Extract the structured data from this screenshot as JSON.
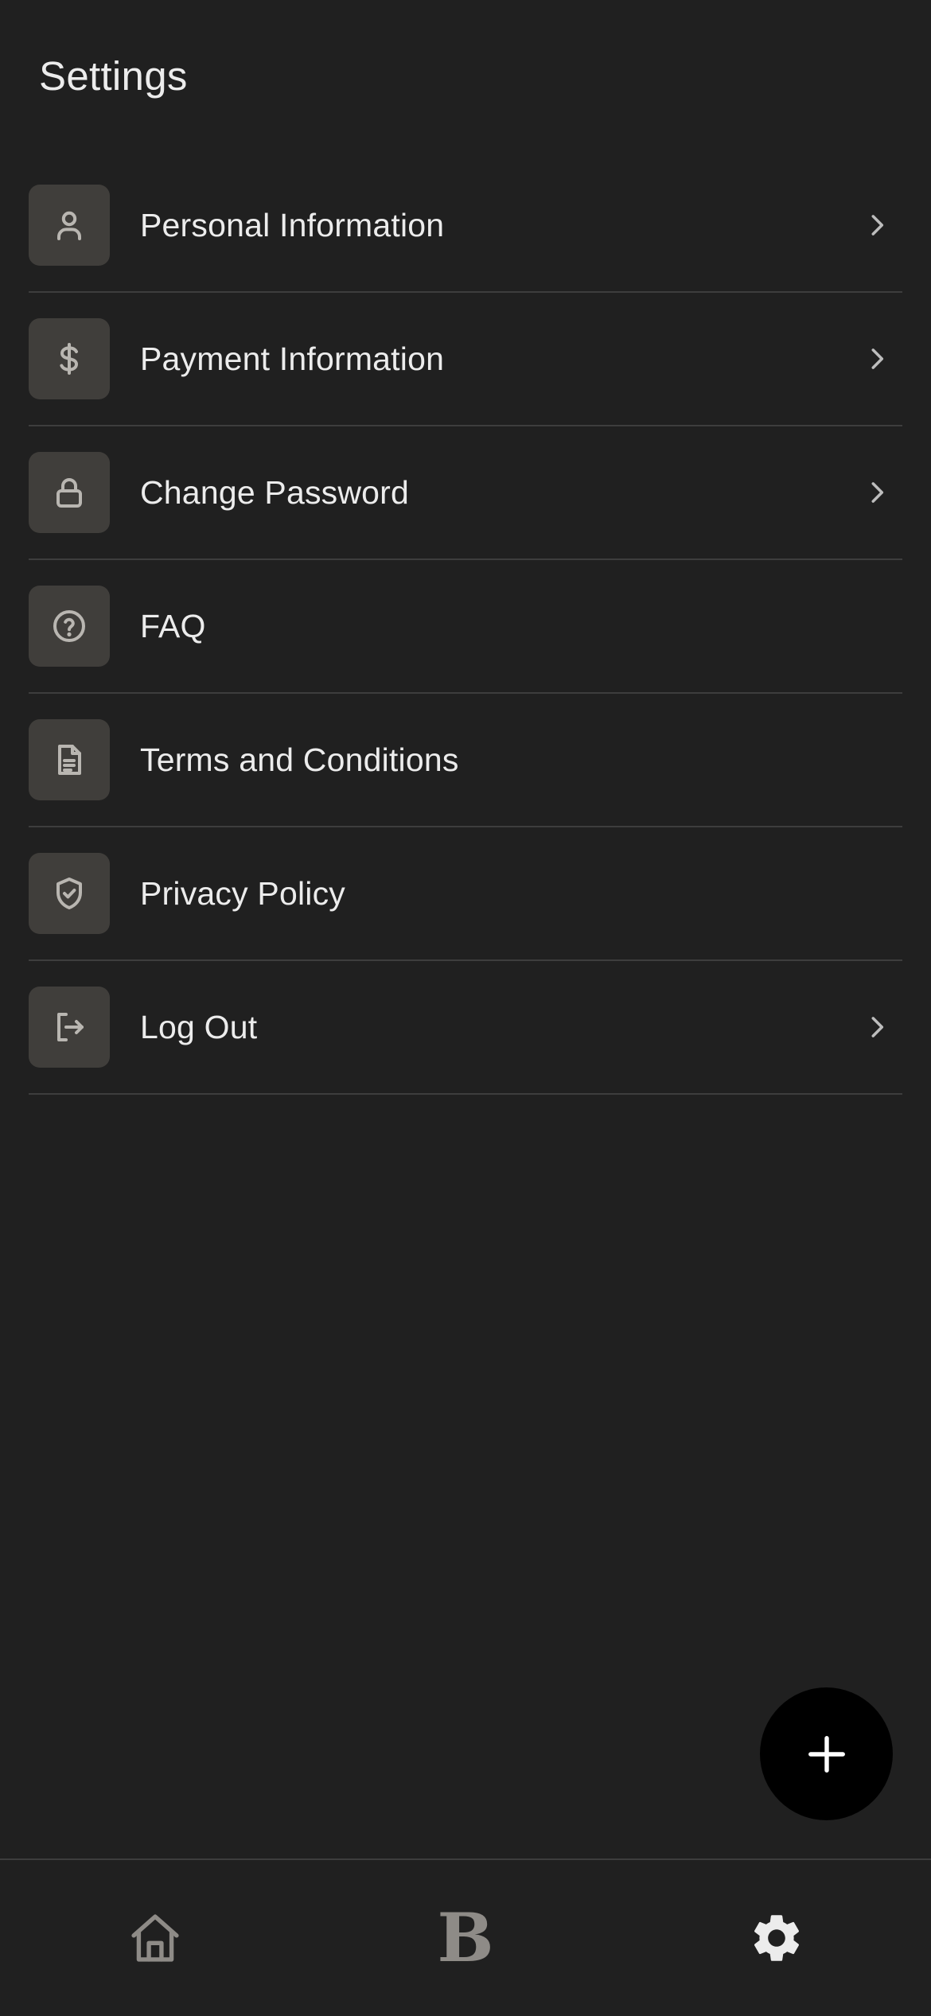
{
  "header": {
    "title": "Settings"
  },
  "settings": {
    "items": [
      {
        "label": "Personal Information",
        "icon": "person-icon",
        "has_chevron": true
      },
      {
        "label": "Payment Information",
        "icon": "dollar-icon",
        "has_chevron": true
      },
      {
        "label": "Change Password",
        "icon": "lock-icon",
        "has_chevron": true
      },
      {
        "label": "FAQ",
        "icon": "question-circle-icon",
        "has_chevron": false
      },
      {
        "label": "Terms and Conditions",
        "icon": "document-icon",
        "has_chevron": false
      },
      {
        "label": "Privacy Policy",
        "icon": "shield-check-icon",
        "has_chevron": false
      },
      {
        "label": "Log Out",
        "icon": "logout-icon",
        "has_chevron": true
      }
    ]
  },
  "fab": {
    "icon": "plus-icon"
  },
  "bottom_nav": {
    "items": [
      {
        "icon": "home-icon",
        "active": false
      },
      {
        "glyph": "B",
        "icon": "brand-logo-icon",
        "active": false
      },
      {
        "icon": "gear-icon",
        "active": true
      }
    ]
  },
  "colors": {
    "background": "#202020",
    "icon_tile": "#403e3b",
    "divider": "#3d3d3d",
    "text": "#ececec",
    "inactive_nav": "#8e8b87",
    "fab": "#000000"
  }
}
